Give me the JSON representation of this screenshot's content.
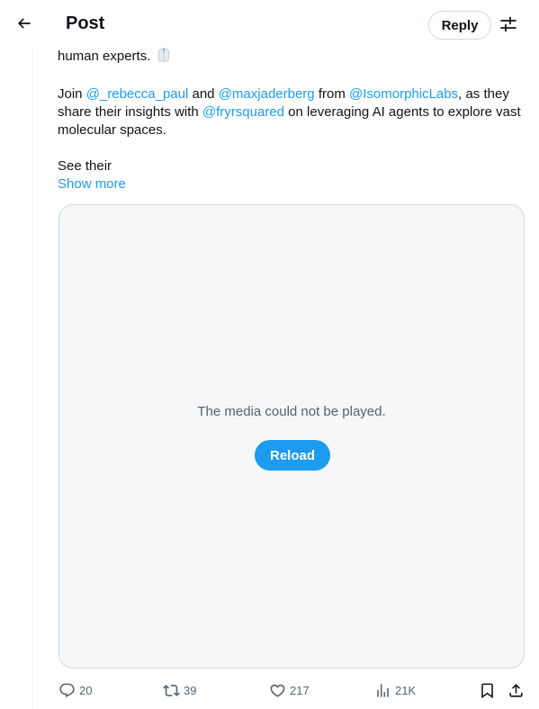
{
  "header": {
    "title": "Post",
    "reply_label": "Reply",
    "back_icon": "arrow-left-icon",
    "filter_icon": "sliders-icon"
  },
  "tweet": {
    "line1": "human experts.",
    "p2": {
      "t1": "Join ",
      "m1": "@_rebecca_paul",
      "t2": " and ",
      "m2": "@maxjaderberg",
      "t3": " from ",
      "m3": "@IsomorphicLabs",
      "t4": ", as they share their insights with ",
      "m4": "@fryrsquared",
      "t5": " on leveraging AI agents to explore vast molecular spaces."
    },
    "p3": "See their",
    "show_more": "Show more"
  },
  "media": {
    "message": "The media could not be played.",
    "reload_label": "Reload"
  },
  "actions": {
    "replies": "20",
    "reposts": "39",
    "likes": "217",
    "views": "21K"
  },
  "colors": {
    "accent": "#1d9bf0",
    "text": "#0f1419",
    "muted": "#536471"
  }
}
